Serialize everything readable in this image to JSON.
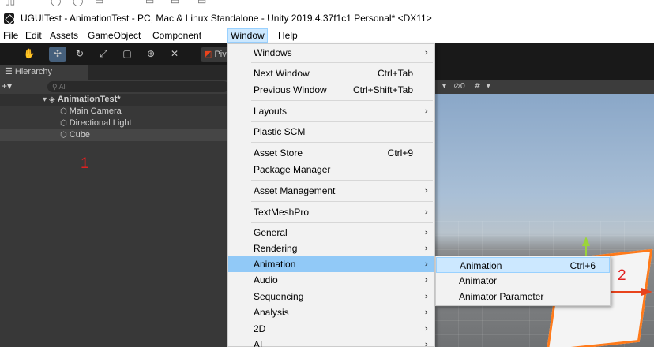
{
  "title_bar": {
    "icon": "unity-icon",
    "title": "UGUITest - AnimationTest - PC, Mac & Linux Standalone - Unity 2019.4.37f1c1 Personal* <DX11>"
  },
  "menubar": {
    "items": [
      {
        "label": "File"
      },
      {
        "label": "Edit"
      },
      {
        "label": "Assets"
      },
      {
        "label": "GameObject"
      },
      {
        "label": "Component"
      },
      {
        "label": "Window"
      },
      {
        "label": "Help"
      }
    ],
    "active": "Window"
  },
  "toolbar": {
    "tools": [
      "hand-icon",
      "move-icon",
      "rotate-icon",
      "scale-icon",
      "rect-tool-icon",
      "transform-tool-icon",
      "custom-tool-icon"
    ],
    "pivot_label": "Pivo"
  },
  "hierarchy": {
    "tab_label": "Hierarchy",
    "plus_label": "+▾",
    "search_placeholder": "All",
    "scene_name": "AnimationTest*",
    "objects": [
      "Main Camera",
      "Directional Light",
      "Cube"
    ],
    "selected": "Cube"
  },
  "scene_toolbar": {
    "hidden_count": "0"
  },
  "annotations": {
    "label_1": "1",
    "label_2": "2",
    "color": "#e02020"
  },
  "window_menu": {
    "items": [
      {
        "label": "Windows",
        "shortcut": "",
        "arrow": "›"
      },
      {
        "label": "Next Window",
        "shortcut": "Ctrl+Tab",
        "arrow": ""
      },
      {
        "label": "Previous Window",
        "shortcut": "Ctrl+Shift+Tab",
        "arrow": ""
      },
      {
        "label": "Layouts",
        "shortcut": "",
        "arrow": "›"
      },
      {
        "label": "Plastic SCM",
        "shortcut": "",
        "arrow": ""
      },
      {
        "label": "Asset Store",
        "shortcut": "Ctrl+9",
        "arrow": ""
      },
      {
        "label": "Package Manager",
        "shortcut": "",
        "arrow": ""
      },
      {
        "label": "Asset Management",
        "shortcut": "",
        "arrow": "›"
      },
      {
        "label": "TextMeshPro",
        "shortcut": "",
        "arrow": "›"
      },
      {
        "label": "General",
        "shortcut": "",
        "arrow": "›"
      },
      {
        "label": "Rendering",
        "shortcut": "",
        "arrow": "›"
      },
      {
        "label": "Animation",
        "shortcut": "",
        "arrow": "›"
      },
      {
        "label": "Audio",
        "shortcut": "",
        "arrow": "›"
      },
      {
        "label": "Sequencing",
        "shortcut": "",
        "arrow": "›"
      },
      {
        "label": "Analysis",
        "shortcut": "",
        "arrow": "›"
      },
      {
        "label": "2D",
        "shortcut": "",
        "arrow": "›"
      },
      {
        "label": "AI",
        "shortcut": "",
        "arrow": "›"
      }
    ],
    "highlighted": "Animation"
  },
  "animation_submenu": {
    "items": [
      {
        "label": "Animation",
        "shortcut": "Ctrl+6"
      },
      {
        "label": "Animator",
        "shortcut": ""
      },
      {
        "label": "Animator Parameter",
        "shortcut": ""
      }
    ],
    "highlighted": "Animation"
  },
  "colors": {
    "editor_bg": "#191919",
    "hierarchy_bg": "#383838",
    "menu_bg": "#f2f2f2",
    "menu_highlight": "#91c9f7",
    "submenu_highlight": "#cce8ff",
    "cube_outline": "#ff7a1a"
  }
}
